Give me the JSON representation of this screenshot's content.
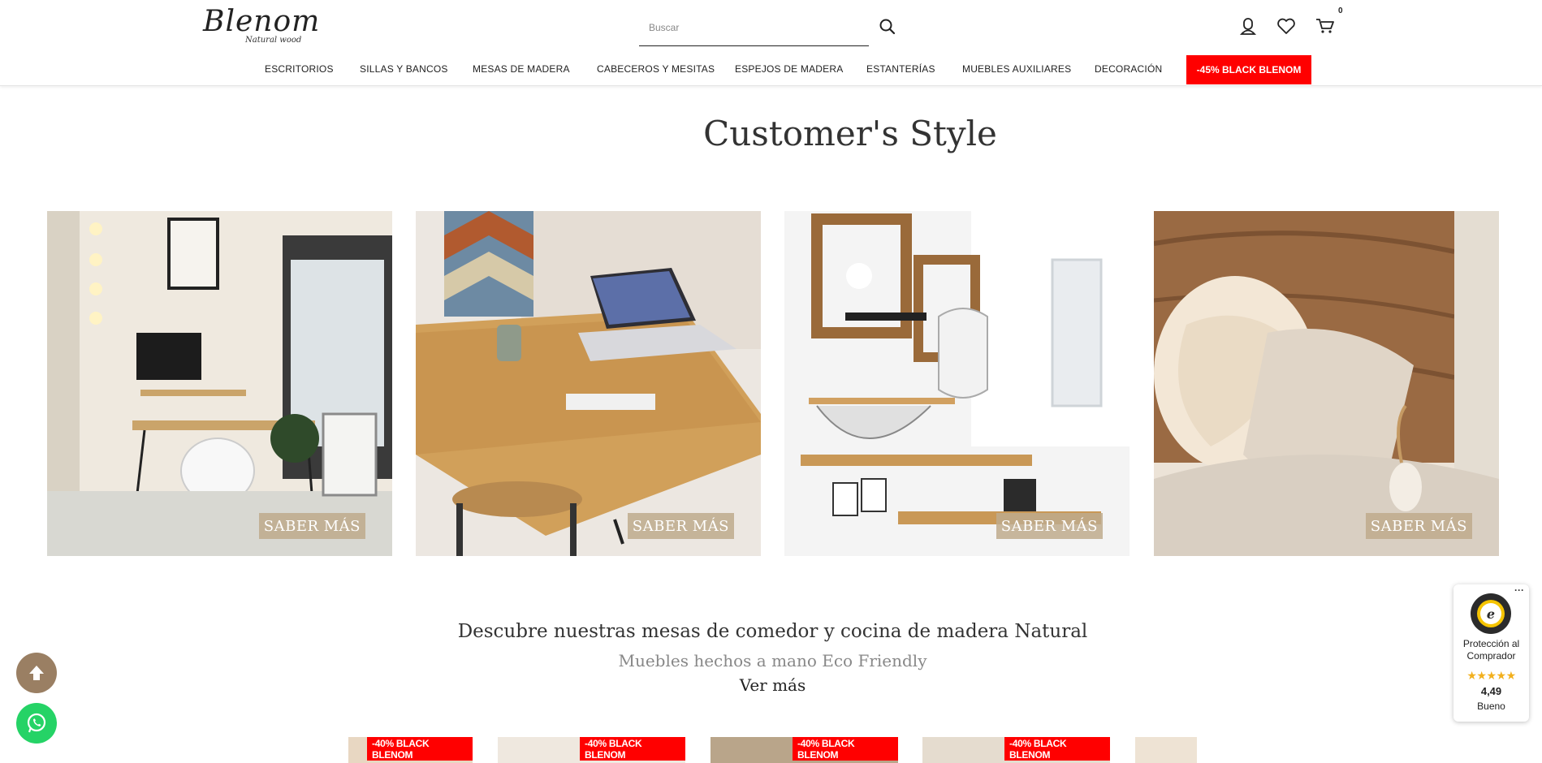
{
  "header": {
    "logo_script": "Blenom",
    "logo_sub": "Natural wood",
    "search_placeholder": "Buscar",
    "cart_count": "0"
  },
  "nav": {
    "items": [
      {
        "label": "ESCRITORIOS"
      },
      {
        "label": "SILLAS Y BANCOS"
      },
      {
        "label": "MESAS DE MADERA"
      },
      {
        "label": "CABECEROS Y MESITAS"
      },
      {
        "label": "ESPEJOS DE MADERA"
      },
      {
        "label": "ESTANTERÍAS"
      },
      {
        "label": "MUEBLES AUXILIARES"
      },
      {
        "label": "DECORACIÓN"
      }
    ],
    "promo": "-45% BLACK BLENOM"
  },
  "section": {
    "title": "Customer's Style"
  },
  "gallery": {
    "cards": [
      {
        "button": "SABER MÁS"
      },
      {
        "button": "SABER MÁS"
      },
      {
        "button": "SABER MÁS"
      },
      {
        "button": "SABER MÁS"
      }
    ]
  },
  "discover": {
    "title": "Descubre nuestras mesas de comedor y cocina de madera Natural",
    "subtitle": "Muebles hechos a mano Eco Friendly",
    "more": "Ver más"
  },
  "products": {
    "badges": [
      "-40% BLACK BLENOM",
      "-40% BLACK BLENOM",
      "-40% BLACK BLENOM",
      "-40% BLACK BLENOM"
    ]
  },
  "trust": {
    "menu": "···",
    "text": "Protección al Comprador",
    "stars": "★★★★★",
    "score": "4,49",
    "label": "Bueno"
  },
  "colors": {
    "promo": "#ff0000",
    "scroll_top": "#9a7f63",
    "whatsapp": "#25d366",
    "stars": "#f2b01e"
  }
}
